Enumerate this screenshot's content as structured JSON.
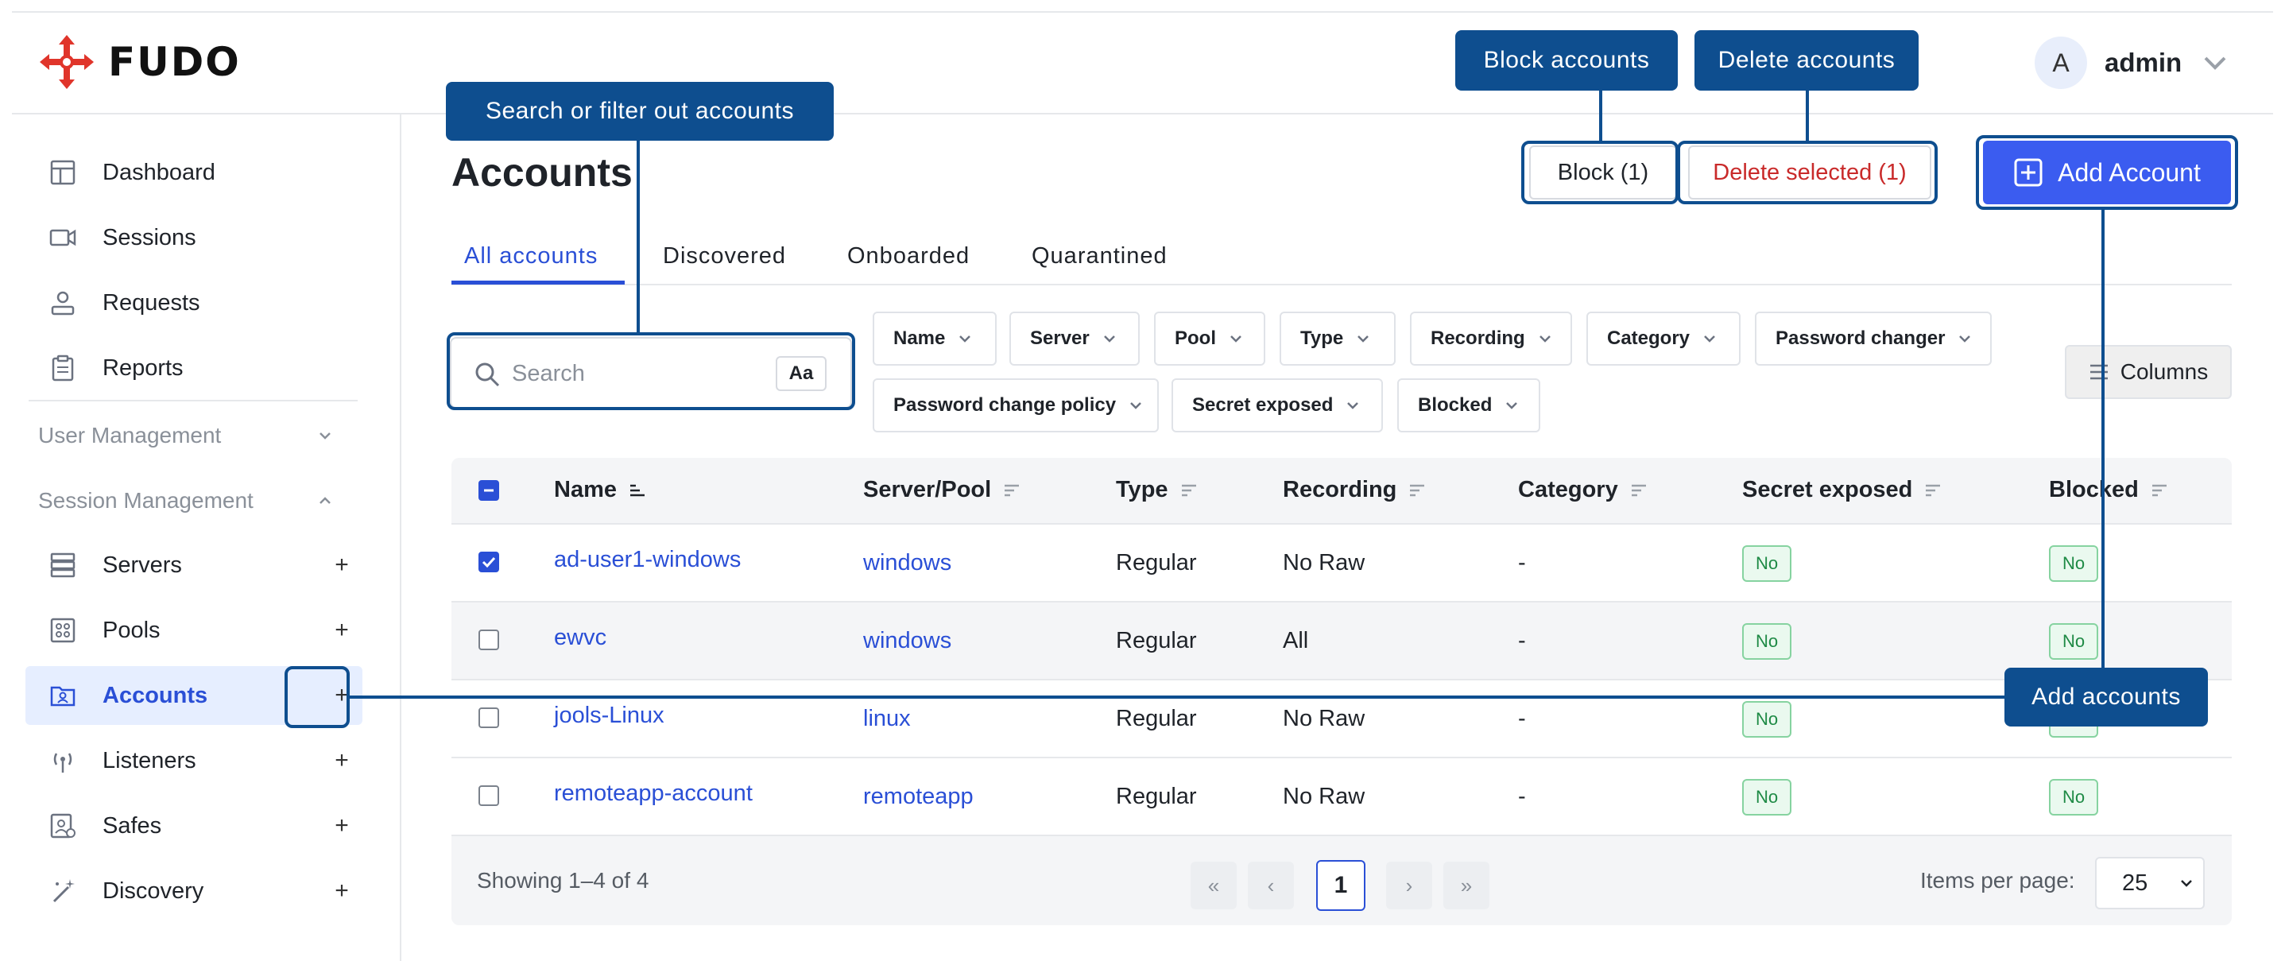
{
  "brand": {
    "name": "FUDO"
  },
  "user": {
    "initial": "A",
    "name": "admin"
  },
  "sidebar": {
    "items": [
      {
        "label": "Dashboard",
        "icon": "dashboard-icon"
      },
      {
        "label": "Sessions",
        "icon": "video-icon"
      },
      {
        "label": "Requests",
        "icon": "requests-icon"
      },
      {
        "label": "Reports",
        "icon": "clipboard-icon"
      }
    ],
    "sections": [
      {
        "label": "User Management",
        "expanded": false
      },
      {
        "label": "Session Management",
        "expanded": true
      }
    ],
    "session_items": [
      {
        "label": "Servers",
        "plus": "+",
        "icon": "server-icon"
      },
      {
        "label": "Pools",
        "plus": "+",
        "icon": "pool-icon"
      },
      {
        "label": "Accounts",
        "plus": "+",
        "icon": "account-folder-icon",
        "active": true
      },
      {
        "label": "Listeners",
        "plus": "+",
        "icon": "broadcast-icon"
      },
      {
        "label": "Safes",
        "plus": "+",
        "icon": "safe-icon"
      },
      {
        "label": "Discovery",
        "plus": "+",
        "icon": "wand-icon"
      }
    ]
  },
  "page": {
    "title": "Accounts"
  },
  "actions": {
    "block": "Block (1)",
    "delete": "Delete selected (1)",
    "add": "Add Account"
  },
  "tabs": [
    {
      "label": "All accounts",
      "active": true
    },
    {
      "label": "Discovered"
    },
    {
      "label": "Onboarded"
    },
    {
      "label": "Quarantined"
    }
  ],
  "search": {
    "placeholder": "Search",
    "case_toggle": "Aa"
  },
  "filters": [
    "Name",
    "Server",
    "Pool",
    "Type",
    "Recording",
    "Category",
    "Password changer",
    "Password change policy",
    "Secret exposed",
    "Blocked"
  ],
  "columns_button": "Columns",
  "table": {
    "headers": [
      "Name",
      "Server/Pool",
      "Type",
      "Recording",
      "Category",
      "Secret exposed",
      "Blocked"
    ],
    "rows": [
      {
        "checked": true,
        "name": "ad-user1-windows",
        "server": "windows",
        "type": "Regular",
        "recording": "No Raw",
        "category": "-",
        "secret": "No",
        "blocked": "No"
      },
      {
        "checked": false,
        "name": "ewvc",
        "server": "windows",
        "type": "Regular",
        "recording": "All",
        "category": "-",
        "secret": "No",
        "blocked": "No"
      },
      {
        "checked": false,
        "name": "jools-Linux",
        "server": "linux",
        "type": "Regular",
        "recording": "No Raw",
        "category": "-",
        "secret": "No",
        "blocked": "No"
      },
      {
        "checked": false,
        "name": "remoteapp-account",
        "server": "remoteapp",
        "type": "Regular",
        "recording": "No Raw",
        "category": "-",
        "secret": "No",
        "blocked": "No"
      }
    ]
  },
  "pagination": {
    "showing": "Showing 1–4 of 4",
    "first": "«",
    "prev": "‹",
    "current": "1",
    "next": "›",
    "last": "»",
    "items_per_page_label": "Items per page:",
    "items_per_page": "25"
  },
  "annotations": {
    "search": "Search or filter out accounts",
    "block": "Block accounts",
    "delete": "Delete accounts",
    "add_accounts": "Add accounts"
  },
  "colors": {
    "accent": "#2a4fd6",
    "primary_button": "#3b5cf0",
    "annotation": "#0e4e8f",
    "danger": "#c92a2a",
    "badge_green": "#1e8a45",
    "logo_red": "#e0352b"
  }
}
